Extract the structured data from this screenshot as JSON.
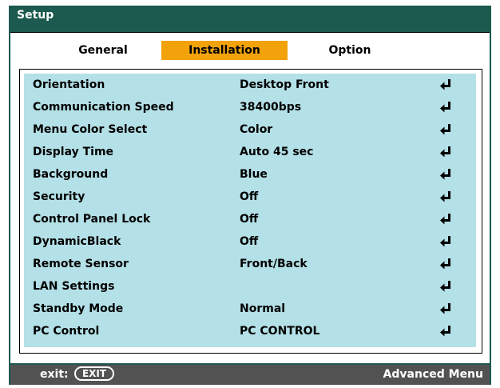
{
  "window": {
    "title": "Setup"
  },
  "tabs": [
    {
      "label": "General",
      "active": false
    },
    {
      "label": "Installation",
      "active": true
    },
    {
      "label": "Option",
      "active": false
    }
  ],
  "settings": [
    {
      "label": "Orientation",
      "value": "Desktop Front",
      "icon": "enter-return-icon"
    },
    {
      "label": "Communication Speed",
      "value": "38400bps",
      "icon": "enter-return-icon"
    },
    {
      "label": "Menu Color Select",
      "value": "Color",
      "icon": "enter-return-icon"
    },
    {
      "label": "Display Time",
      "value": "Auto 45 sec",
      "icon": "enter-return-icon"
    },
    {
      "label": "Background",
      "value": "Blue",
      "icon": "enter-return-icon"
    },
    {
      "label": "Security",
      "value": "Off",
      "icon": "enter-return-icon"
    },
    {
      "label": "Control Panel Lock",
      "value": "Off",
      "icon": "enter-return-icon"
    },
    {
      "label": "DynamicBlack",
      "value": "Off",
      "icon": "enter-return-icon"
    },
    {
      "label": "Remote Sensor",
      "value": "Front/Back",
      "icon": "enter-return-icon"
    },
    {
      "label": "LAN Settings",
      "value": "",
      "icon": "enter-return-icon"
    },
    {
      "label": "Standby Mode",
      "value": "Normal",
      "icon": "enter-return-icon"
    },
    {
      "label": "PC Control",
      "value": "PC CONTROL",
      "icon": "enter-return-icon"
    }
  ],
  "footer": {
    "exit_label": "exit:",
    "exit_button": "EXIT",
    "advanced_menu": "Advanced Menu"
  },
  "colors": {
    "title_bar": "#1c5a4f",
    "active_tab": "#f2a20a",
    "panel_bg": "#b4e0e7",
    "footer_bar": "#525252"
  }
}
